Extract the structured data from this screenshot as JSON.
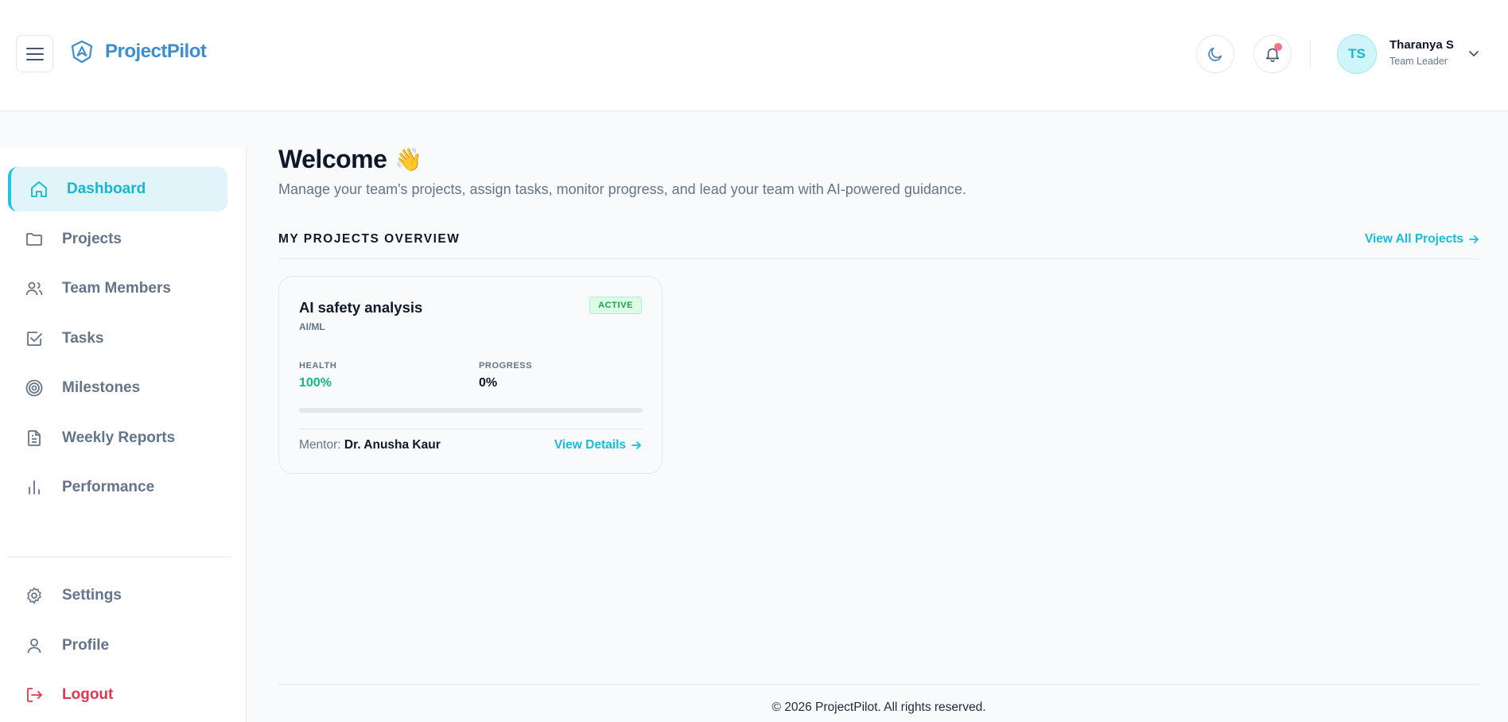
{
  "header": {
    "brand": "ProjectPilot",
    "user": {
      "initials": "TS",
      "name": "Tharanya S",
      "role": "Team Leader"
    }
  },
  "sidebar": {
    "items": [
      {
        "label": "Dashboard",
        "icon": "home-icon",
        "active": true
      },
      {
        "label": "Projects",
        "icon": "folder-icon"
      },
      {
        "label": "Team Members",
        "icon": "users-icon"
      },
      {
        "label": "Tasks",
        "icon": "checkbox-icon"
      },
      {
        "label": "Milestones",
        "icon": "target-icon"
      },
      {
        "label": "Weekly Reports",
        "icon": "file-icon"
      },
      {
        "label": "Performance",
        "icon": "bar-chart-icon"
      }
    ],
    "bottom_items": [
      {
        "label": "Settings",
        "icon": "gear-icon"
      },
      {
        "label": "Profile",
        "icon": "user-icon"
      },
      {
        "label": "Logout",
        "icon": "logout-icon"
      }
    ]
  },
  "main": {
    "welcome_title": "Welcome",
    "welcome_emoji": "👋",
    "welcome_subtitle": "Manage your team's projects, assign tasks, monitor progress, and lead your team with AI-powered guidance.",
    "section_title": "MY PROJECTS OVERVIEW",
    "view_all_label": "View All Projects",
    "projects": [
      {
        "title": "AI safety analysis",
        "category": "AI/ML",
        "status": "ACTIVE",
        "health_label": "HEALTH",
        "health_value": "100%",
        "progress_label": "PROGRESS",
        "progress_value": "0%",
        "progress_fraction": 0,
        "mentor_label": "Mentor:",
        "mentor_name": "Dr. Anusha Kaur",
        "view_details_label": "View Details"
      }
    ]
  },
  "footer": {
    "text": "© 2026 ProjectPilot. All rights reserved."
  },
  "colors": {
    "accent": "#19bcd8",
    "brand": "#3b8fd0",
    "health": "#10b981",
    "logout": "#e3364d",
    "notification_dot": "#f87185"
  }
}
